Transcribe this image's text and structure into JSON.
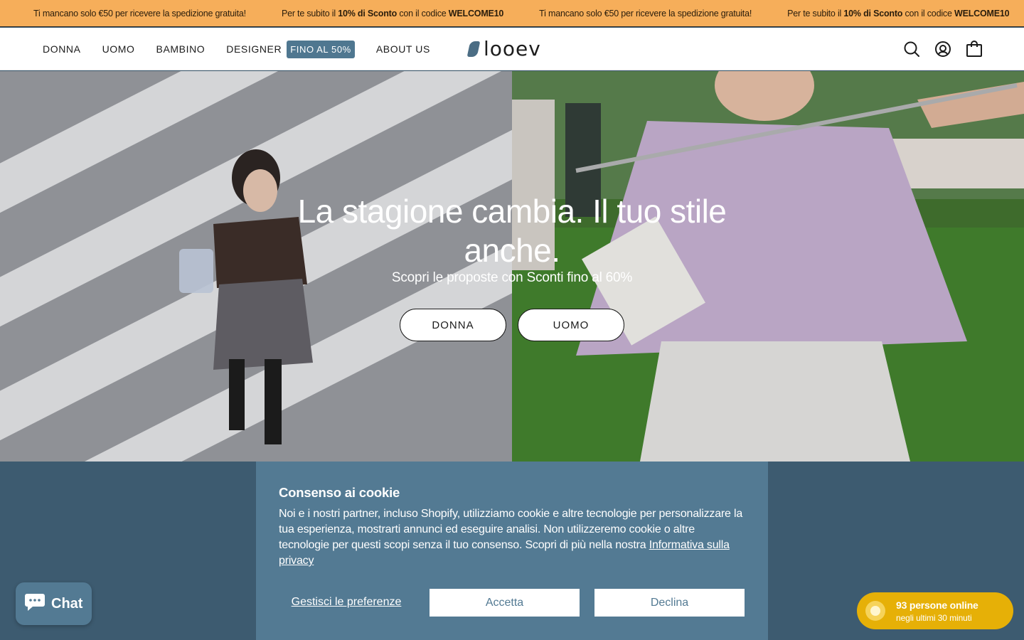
{
  "announcement": {
    "messages": [
      {
        "pre": "Ti mancano solo €50 per ricevere la spedizione gratuita!",
        "bold": "",
        "post": ""
      },
      {
        "pre": "Per te subito il ",
        "bold": "10% di Sconto",
        "post": " con il codice ",
        "code": "WELCOME10"
      },
      {
        "pre": "Ti mancano solo €50 per ricevere la spedizione gratuita!",
        "bold": "",
        "post": ""
      },
      {
        "pre": "Per te subito il ",
        "bold": "10% di Sconto",
        "post": " con il codice ",
        "code": "WELCOME10"
      }
    ]
  },
  "nav": {
    "items": [
      {
        "label": "DONNA"
      },
      {
        "label": "UOMO"
      },
      {
        "label": "BAMBINO"
      },
      {
        "label": "DESIGNER",
        "badge": "FINO AL 50%"
      },
      {
        "label": "ABOUT US"
      }
    ]
  },
  "logo": {
    "text": "looev"
  },
  "header_icons": [
    "search-icon",
    "account-icon",
    "cart-bag-icon"
  ],
  "hero": {
    "title": "La stagione cambia. Il tuo stile anche.",
    "subtitle": "Scopri le proposte con Sconti fino al 60%",
    "buttons": [
      {
        "label": "DONNA"
      },
      {
        "label": "UOMO"
      }
    ]
  },
  "cookie": {
    "title": "Consenso ai cookie",
    "text": "Noi e i nostri partner, incluso Shopify, utilizziamo cookie e altre tecnologie per personalizzare la tua esperienza, mostrarti annunci ed eseguire analisi. Non utilizzeremo cookie o altre tecnologie per questi scopi senza il tuo consenso. Scopri di più nella nostra ",
    "link": "Informativa sulla privacy",
    "manage": "Gestisci le preferenze",
    "accept": "Accetta",
    "decline": "Declina"
  },
  "chat": {
    "label": "Chat"
  },
  "online": {
    "title": "93 persone online",
    "subtitle": "negli ultimi 30 minuti"
  },
  "colors": {
    "announce_bg": "#f6ae5a",
    "brand_blue": "#537a93",
    "badge_blue": "#4f7790",
    "online_yellow": "#e6b007",
    "page_bg": "#3d5b70"
  }
}
